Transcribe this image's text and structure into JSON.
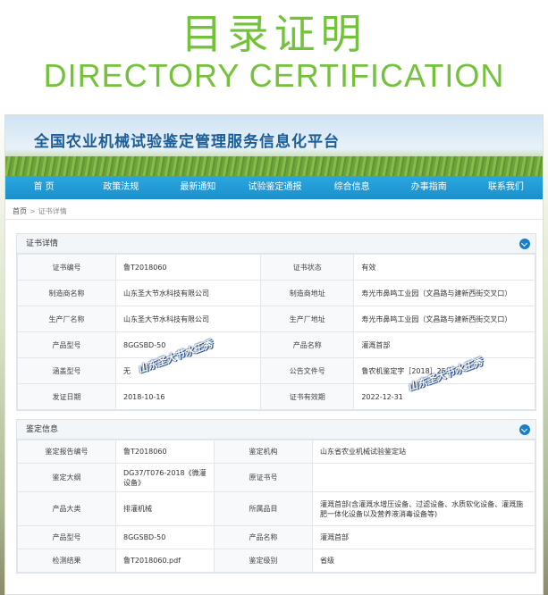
{
  "hero": {
    "title_cn": "目录证明",
    "title_en": "DIRECTORY CERTIFICATION"
  },
  "site": {
    "title": "全国农业机械试验鉴定管理服务信息化平台"
  },
  "nav": [
    "首 页",
    "政策法规",
    "最新通知",
    "试验鉴定通报",
    "综合信息",
    "办事指南",
    "联系我们"
  ],
  "breadcrumb": {
    "home": "首页",
    "separator": ">",
    "current": "证书详情"
  },
  "certificate": {
    "heading": "证书详情",
    "rows": [
      [
        "证书编号",
        "鲁T2018060",
        "证书状态",
        "有效"
      ],
      [
        "制造商名称",
        "山东圣大节水科技有限公司",
        "制造商地址",
        "寿光市鼻鸣工业园（文昌路与建新西街交叉口）"
      ],
      [
        "生产厂名称",
        "山东圣大节水科技有限公司",
        "生产厂地址",
        "寿光市鼻鸣工业园（文昌路与建新西街交叉口）"
      ],
      [
        "产品型号",
        "8GGSBD-50",
        "产品名称",
        "灌溉首部"
      ],
      [
        "涵盖型号",
        "无",
        "公告文件号",
        "鲁农机鉴定字［2018］25号"
      ],
      [
        "发证日期",
        "2018-10-16",
        "证书有效期",
        "2022-12-31"
      ]
    ]
  },
  "appraisal": {
    "heading": "鉴定信息",
    "rows": [
      [
        "鉴定报告编号",
        "鲁T2018060",
        "鉴定机构",
        "山东省农业机械试验鉴定站"
      ],
      [
        "鉴定大纲",
        "DG37/T076-2018《微灌设备》",
        "原证书号",
        ""
      ],
      [
        "产品大类",
        "排灌机械",
        "所属品目",
        "灌溉首部(含灌溉水增压设备、过滤设备、水质软化设备、灌溉施肥一体化设备以及营养液消毒设备等)"
      ],
      [
        "产品型号",
        "8GGSBD-50",
        "产品名称",
        "灌溉首部"
      ],
      [
        "检测结果",
        "鲁T2018060.pdf",
        "鉴定级别",
        "省级"
      ]
    ]
  },
  "watermark": "山东圣大节水王秀"
}
